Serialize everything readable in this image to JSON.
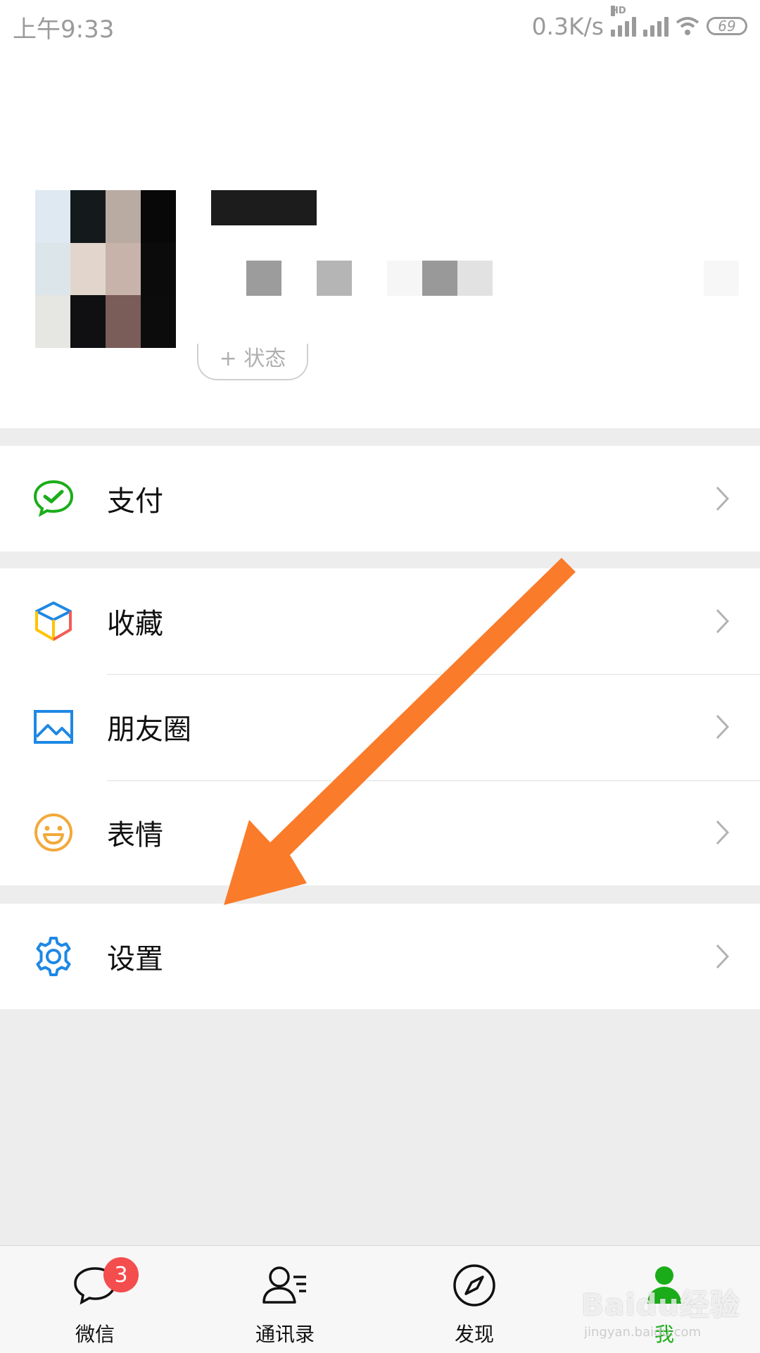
{
  "status_bar": {
    "time": "上午9:33",
    "network_speed": "0.3K/s",
    "hd_label": "HD",
    "battery": "69"
  },
  "profile": {
    "status_button_label": "+ 状态"
  },
  "menu": {
    "group1": [
      {
        "label": "支付",
        "icon": "wechat-pay-icon"
      }
    ],
    "group2": [
      {
        "label": "收藏",
        "icon": "favorites-cube-icon"
      },
      {
        "label": "朋友圈",
        "icon": "moments-image-icon"
      },
      {
        "label": "表情",
        "icon": "smiley-icon"
      }
    ],
    "group3": [
      {
        "label": "设置",
        "icon": "gear-icon"
      }
    ]
  },
  "tabbar": {
    "tabs": [
      {
        "label": "微信",
        "icon": "chat-bubble-icon",
        "badge": "3",
        "active": false
      },
      {
        "label": "通讯录",
        "icon": "contacts-icon",
        "active": false
      },
      {
        "label": "发现",
        "icon": "compass-icon",
        "active": false
      },
      {
        "label": "我",
        "icon": "person-icon",
        "active": true
      }
    ]
  },
  "watermark": {
    "text": "Baidu经验",
    "url_text": "jingyan.baidu.com"
  },
  "colors": {
    "accent_green": "#1aad19",
    "badge_red": "#f44d4d",
    "arrow_orange": "#fa7b2a",
    "settings_blue": "#1e88e5"
  }
}
